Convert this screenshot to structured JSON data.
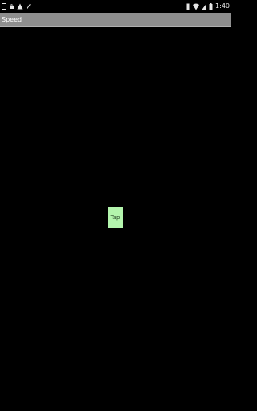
{
  "status_bar": {
    "time": "1:40",
    "left_icons": [
      "notification-icon",
      "android-debug-icon",
      "warning-icon",
      "paint-icon"
    ],
    "right_icons": [
      "vibrate-icon",
      "wifi-icon",
      "signal-icon",
      "battery-icon"
    ]
  },
  "title_bar": {
    "title": "Speed"
  },
  "main": {
    "tap_button_label": "Tap",
    "tap_button_color": "#b3f5ad",
    "background_color": "#000000"
  }
}
